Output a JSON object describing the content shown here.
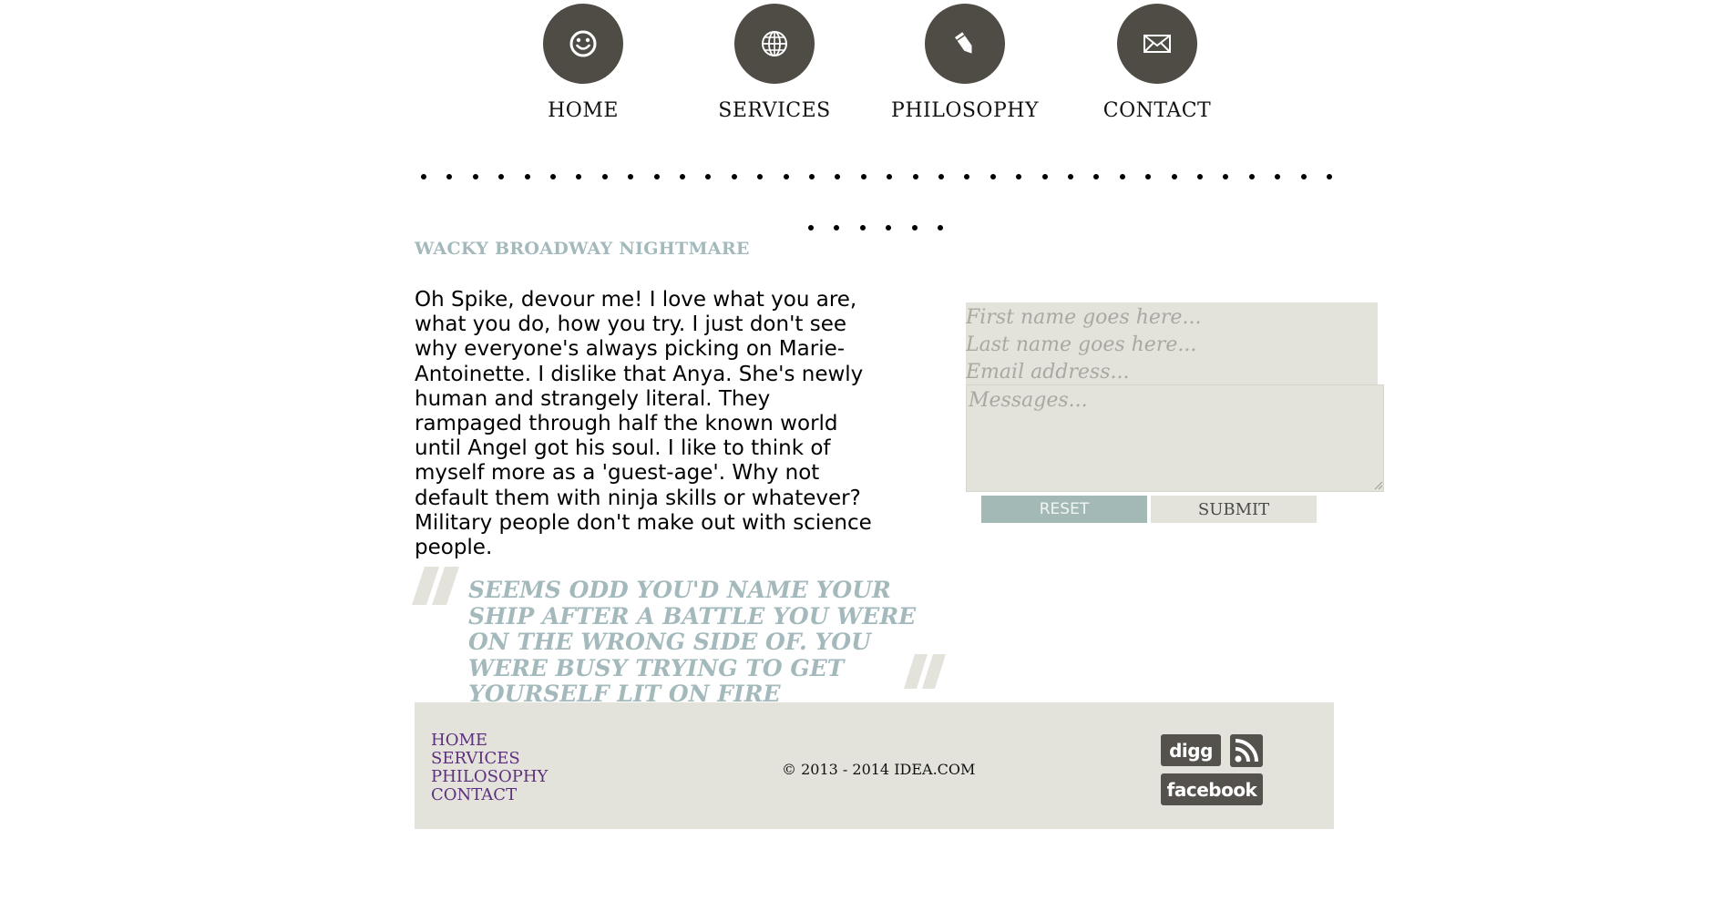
{
  "nav": {
    "items": [
      {
        "label": "HOME",
        "icon": "smiley-icon"
      },
      {
        "label": "SERVICES",
        "icon": "globe-icon"
      },
      {
        "label": "PHILOSOPHY",
        "icon": "pencil-icon"
      },
      {
        "label": "CONTACT",
        "icon": "envelope-icon"
      }
    ]
  },
  "article": {
    "heading": "WACKY BROADWAY NIGHTMARE",
    "body": "Oh Spike, devour me! I love what you are, what you do, how you try. I just don't see why everyone's always picking on Marie-Antoinette. I dislike that Anya. She's newly human and strangely literal. They rampaged through half the known world until Angel got his soul. I like to think of myself more as a 'guest-age'. Why not default them with ninja skills or whatever? Military people don't make out with science people."
  },
  "quote": {
    "text": "SEEMS ODD YOU'D NAME YOUR SHIP AFTER A BATTLE YOU WERE ON THE WRONG SIDE OF. YOU WERE BUSY TRYING TO GET YOURSELF LIT ON FIRE"
  },
  "form": {
    "first_name_placeholder": "First name goes here...",
    "last_name_placeholder": "Last name goes here...",
    "email_placeholder": "Email address...",
    "message_placeholder": "Messages...",
    "reset_label": "RESET",
    "submit_label": "SUBMIT"
  },
  "footer": {
    "links": [
      "HOME",
      "SERVICES",
      "PHILOSOPHY",
      "CONTACT"
    ],
    "copyright": "© 2013 - 2014 IDEA.COM",
    "social": {
      "digg_label": "digg",
      "facebook_label": "facebook",
      "rss_icon": "rss-icon"
    }
  },
  "colors": {
    "nav_circle": "#4f4b45",
    "accent_teal": "#a3b9bc",
    "panel_beige": "#e3e3dc",
    "footer_link": "#5d2f7d",
    "social_bg": "#55524d"
  }
}
